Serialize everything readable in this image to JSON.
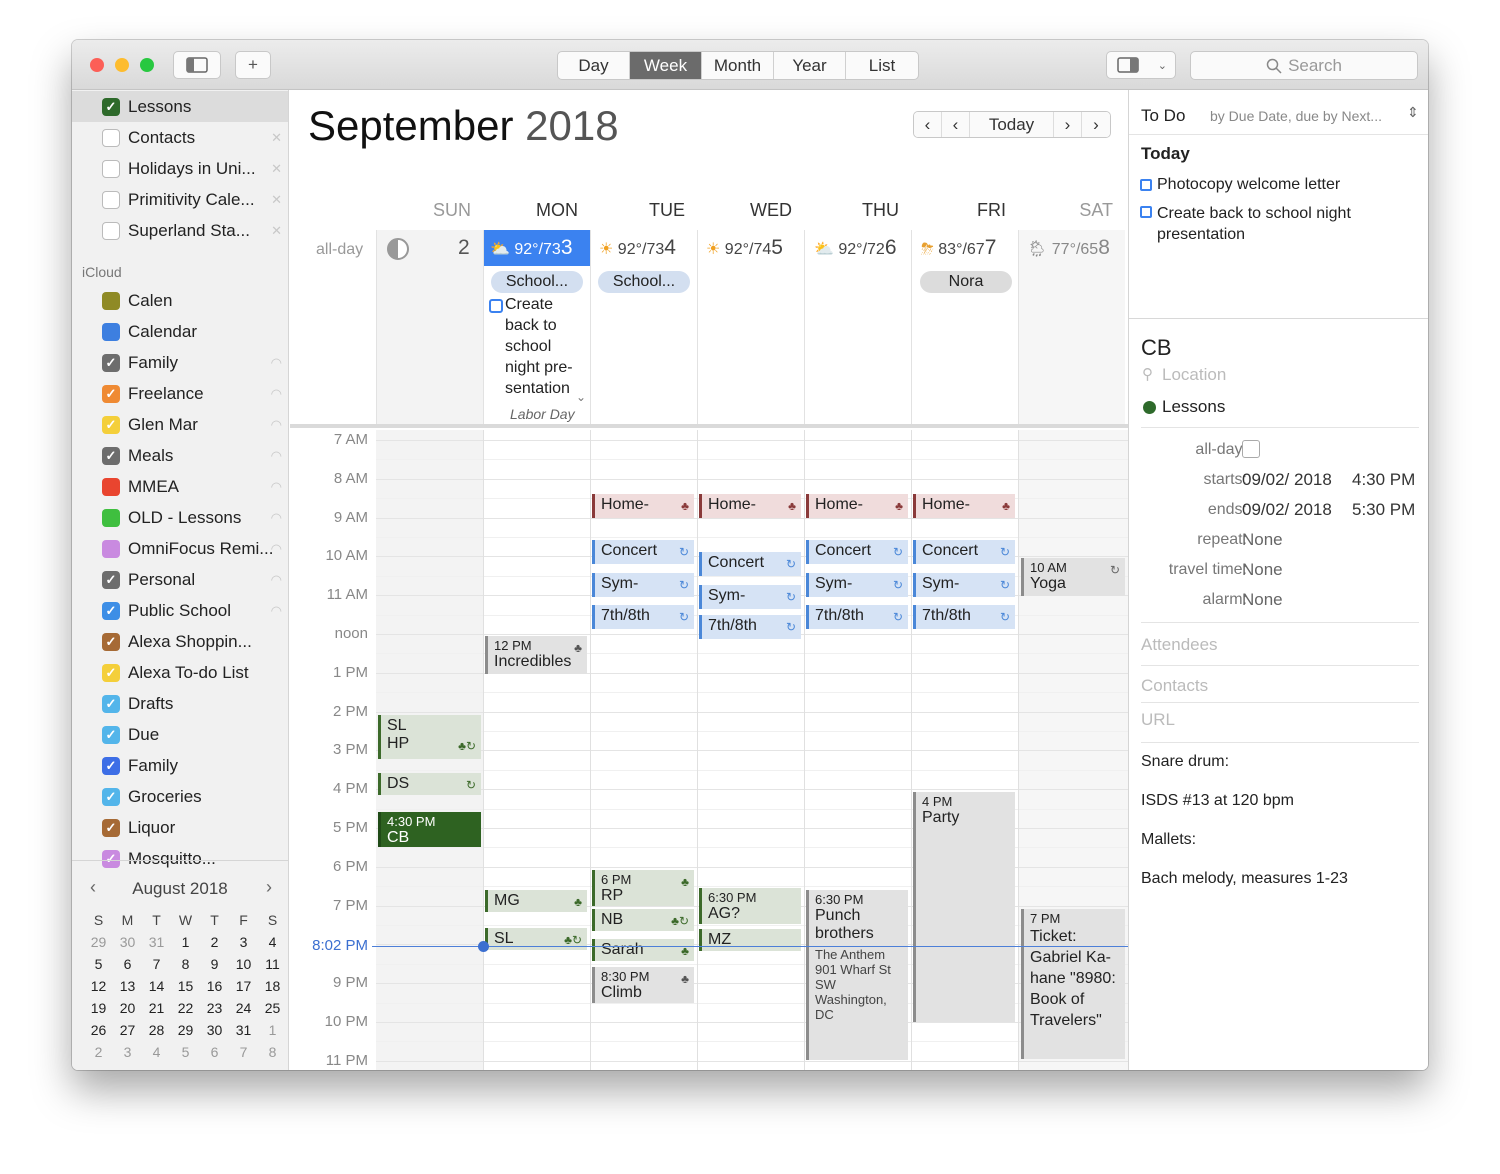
{
  "toolbar": {
    "views": [
      "Day",
      "Week",
      "Month",
      "Year",
      "List"
    ],
    "active_view": "Week",
    "search_placeholder": "Search"
  },
  "sidebar": {
    "items": [
      {
        "label": "Lessons",
        "color": "#2e6a2b",
        "checked": true
      },
      {
        "label": "Contacts",
        "color": "#c9c9c9",
        "checked": false
      },
      {
        "label": "Holidays in Uni...",
        "color": "#c9c9c9",
        "checked": false
      },
      {
        "label": "Primitivity Cale...",
        "color": "#c9c9c9",
        "checked": false
      },
      {
        "label": "Superland Sta...",
        "color": "#c9c9c9",
        "checked": false
      }
    ],
    "icloud_label": "iCloud",
    "icloud_items": [
      {
        "label": "Calen",
        "color": "#8f8a25",
        "checked": false
      },
      {
        "label": "Calendar",
        "color": "#3d7fe0",
        "checked": false
      },
      {
        "label": "Family",
        "color": "#6d6d6d",
        "checked": true
      },
      {
        "label": "Freelance",
        "color": "#ef8a33",
        "checked": true
      },
      {
        "label": "Glen Mar",
        "color": "#f4cf3a",
        "checked": true
      },
      {
        "label": "Meals",
        "color": "#6d6d6d",
        "checked": true
      },
      {
        "label": "MMEA",
        "color": "#e9452f",
        "checked": false
      },
      {
        "label": "OLD - Lessons",
        "color": "#3fbf3f",
        "checked": false
      },
      {
        "label": "OmniFocus Remi...",
        "color": "#c98ae0",
        "checked": false
      },
      {
        "label": "Personal",
        "color": "#6d6d6d",
        "checked": true
      },
      {
        "label": "Public School",
        "color": "#3d8ee6",
        "checked": true
      },
      {
        "label": "Alexa Shoppin...",
        "color": "#a66a35",
        "checked": true
      },
      {
        "label": "Alexa To-do List",
        "color": "#f4cf3a",
        "checked": true
      },
      {
        "label": "Drafts",
        "color": "#53b5ea",
        "checked": true
      },
      {
        "label": "Due",
        "color": "#53b5ea",
        "checked": true
      },
      {
        "label": "Family",
        "color": "#3d6ee6",
        "checked": true
      },
      {
        "label": "Groceries",
        "color": "#53b5ea",
        "checked": true
      },
      {
        "label": "Liquor",
        "color": "#a66a35",
        "checked": true
      },
      {
        "label": "Mosquitto...",
        "color": "#c98ae0",
        "checked": true
      }
    ],
    "mini_calendar": {
      "title": "August 2018",
      "dow": [
        "S",
        "M",
        "T",
        "W",
        "T",
        "F",
        "S"
      ],
      "weeks": [
        [
          "29",
          "30",
          "31",
          "1",
          "2",
          "3",
          "4"
        ],
        [
          "5",
          "6",
          "7",
          "8",
          "9",
          "10",
          "11"
        ],
        [
          "12",
          "13",
          "14",
          "15",
          "16",
          "17",
          "18"
        ],
        [
          "19",
          "20",
          "21",
          "22",
          "23",
          "24",
          "25"
        ],
        [
          "26",
          "27",
          "28",
          "29",
          "30",
          "31",
          "1"
        ],
        [
          "2",
          "3",
          "4",
          "5",
          "6",
          "7",
          "8"
        ]
      ]
    }
  },
  "main": {
    "month": "September",
    "year": "2018",
    "today_label": "Today",
    "allday_label": "all-day",
    "days": [
      {
        "name": "SUN",
        "num": "2",
        "weather": ""
      },
      {
        "name": "MON",
        "num": "3",
        "weather": "92°/73"
      },
      {
        "name": "TUE",
        "num": "4",
        "weather": "92°/73"
      },
      {
        "name": "WED",
        "num": "5",
        "weather": "92°/74"
      },
      {
        "name": "THU",
        "num": "6",
        "weather": "92°/72"
      },
      {
        "name": "FRI",
        "num": "7",
        "weather": "83°/67"
      },
      {
        "name": "SAT",
        "num": "8",
        "weather": "77°/65"
      }
    ],
    "allday_events": {
      "mon_pill": "School...",
      "tue_pill": "School...",
      "fri_pill": "Nora",
      "mon_todo": "Create back to school night pre- sentation",
      "mon_holiday": "Labor Day"
    },
    "hours": [
      "7 AM",
      "8 AM",
      "9 AM",
      "10 AM",
      "11 AM",
      "noon",
      "1 PM",
      "2 PM",
      "3 PM",
      "4 PM",
      "5 PM",
      "6 PM",
      "7 PM",
      "9 PM",
      "10 PM",
      "11 PM"
    ],
    "now_label": "8:02 PM",
    "events": {
      "home": "Home-",
      "concert": "Concert",
      "sym": "Sym-",
      "grade": "7th/8th",
      "yoga_time": "10 AM",
      "yoga": "Yoga",
      "incredibles_time": "12 PM",
      "incredibles": "Incredibles",
      "sl": "SL",
      "hp": "HP",
      "ds": "DS",
      "cb_time": "4:30 PM",
      "cb": "CB",
      "party_time": "4 PM",
      "party": "Party",
      "mg": "MG",
      "sl2": "SL",
      "rp_time": "6 PM",
      "rp": "RP",
      "nb": "NB",
      "sarah": "Sarah",
      "climb_time": "8:30 PM",
      "climb": "Climb",
      "ag_time": "6:30 PM",
      "ag": "AG?",
      "mz": "MZ",
      "punch_time": "6:30 PM",
      "punch": "Punch brothers",
      "punch_loc": "The Anthem 901 Wharf St SW Washington, DC",
      "ticket_time": "7 PM",
      "ticket": "Ticket: Gabriel Ka- hane \"8980: Book of Travelers\""
    }
  },
  "todo": {
    "title": "To Do",
    "sort": "by Due Date, due by Next...",
    "today": "Today",
    "items": [
      "Photocopy welcome letter",
      "Create back to school night presentation"
    ]
  },
  "detail": {
    "title": "CB",
    "location_placeholder": "Location",
    "calendar": "Lessons",
    "allday_label": "all-day:",
    "starts_label": "starts:",
    "starts_date": "09/02/ 2018",
    "starts_time": "4:30 PM",
    "ends_label": "ends:",
    "ends_date": "09/02/ 2018",
    "ends_time": "5:30 PM",
    "repeat_label": "repeat:",
    "repeat": "None",
    "travel_label": "travel time:",
    "travel": "None",
    "alarm_label": "alarm:",
    "alarm": "None",
    "attendees": "Attendees",
    "contacts": "Contacts",
    "url": "URL",
    "notes": [
      "Snare drum:",
      "ISDS #13 at 120 bpm",
      "Mallets:",
      "Bach melody, measures 1-23"
    ]
  }
}
